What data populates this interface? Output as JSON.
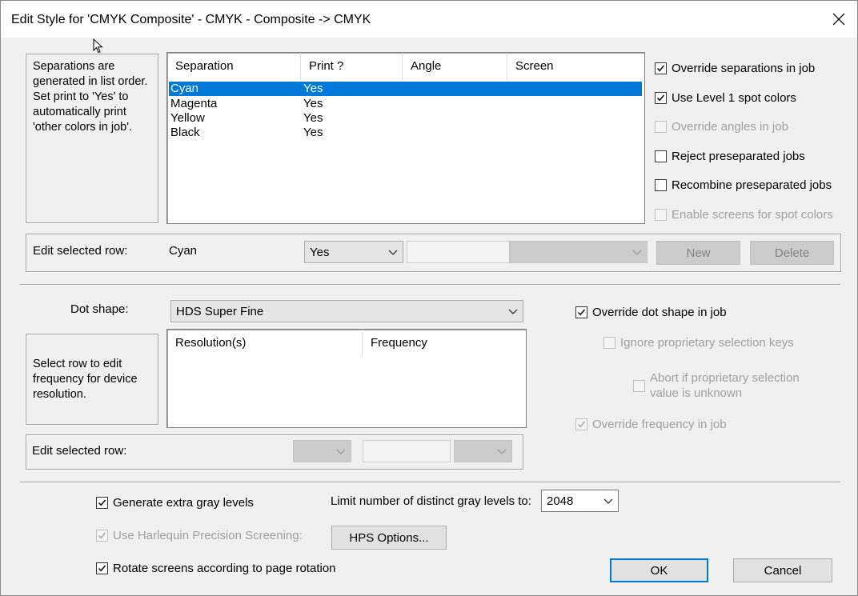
{
  "window": {
    "title": "Edit Style for 'CMYK Composite' - CMYK - Composite -> CMYK"
  },
  "separations": {
    "hint": "Separations are generated in list order.\nSet print to 'Yes' to automatically print 'other colors in job'.",
    "columns": [
      "Separation",
      "Print ?",
      "Angle",
      "Screen"
    ],
    "rows": [
      {
        "separation": "Cyan",
        "print": "Yes",
        "angle": "",
        "screen": ""
      },
      {
        "separation": "Magenta",
        "print": "Yes",
        "angle": "",
        "screen": ""
      },
      {
        "separation": "Yellow",
        "print": "Yes",
        "angle": "",
        "screen": ""
      },
      {
        "separation": "Black",
        "print": "Yes",
        "angle": "",
        "screen": ""
      }
    ],
    "selected_row": 0,
    "edit_label": "Edit selected row:",
    "edit_name": "Cyan",
    "edit_print_value": "Yes",
    "new_label": "New",
    "delete_label": "Delete"
  },
  "options": {
    "override_separations": {
      "label": "Override separations in job",
      "checked": true,
      "enabled": true
    },
    "use_level1_spot": {
      "label": "Use Level 1 spot colors",
      "checked": true,
      "enabled": true
    },
    "override_angles": {
      "label": "Override angles in job",
      "checked": false,
      "enabled": false
    },
    "reject_preseparated": {
      "label": "Reject preseparated jobs",
      "checked": false,
      "enabled": true
    },
    "recombine_preseparated": {
      "label": "Recombine preseparated jobs",
      "checked": false,
      "enabled": true
    },
    "enable_screens_spot": {
      "label": "Enable screens for spot colors",
      "checked": false,
      "enabled": false
    }
  },
  "dot": {
    "label": "Dot shape:",
    "value": "HDS Super Fine",
    "override_dot": {
      "label": "Override dot shape in job",
      "checked": true,
      "enabled": true
    },
    "ignore_keys": {
      "label": "Ignore proprietary selection keys",
      "checked": false,
      "enabled": false
    },
    "abort_unknown": {
      "label_line1": "Abort if proprietary selection",
      "label_line2": "value is unknown",
      "checked": false,
      "enabled": false
    },
    "override_frequency": {
      "label": "Override frequency in job",
      "checked": true,
      "enabled": false
    }
  },
  "frequency": {
    "hint": "Select row to edit frequency for device resolution.",
    "columns": [
      "Resolution(s)",
      "Frequency"
    ],
    "rows": [],
    "edit_label": "Edit selected row:"
  },
  "gray": {
    "generate_extra": {
      "label": "Generate extra gray levels",
      "checked": true,
      "enabled": true
    },
    "limit_label": "Limit number of distinct gray levels to:",
    "limit_value": "2048",
    "hps": {
      "label": "Use Harlequin Precision Screening:",
      "checked": true,
      "enabled": false
    },
    "hps_options_label": "HPS Options...",
    "rotate": {
      "label": "Rotate screens according to page rotation",
      "checked": true,
      "enabled": true
    }
  },
  "buttons": {
    "ok": "OK",
    "cancel": "Cancel"
  },
  "colors": {
    "selection": "#0078d7",
    "dialog_bg": "#f0f0f0"
  }
}
